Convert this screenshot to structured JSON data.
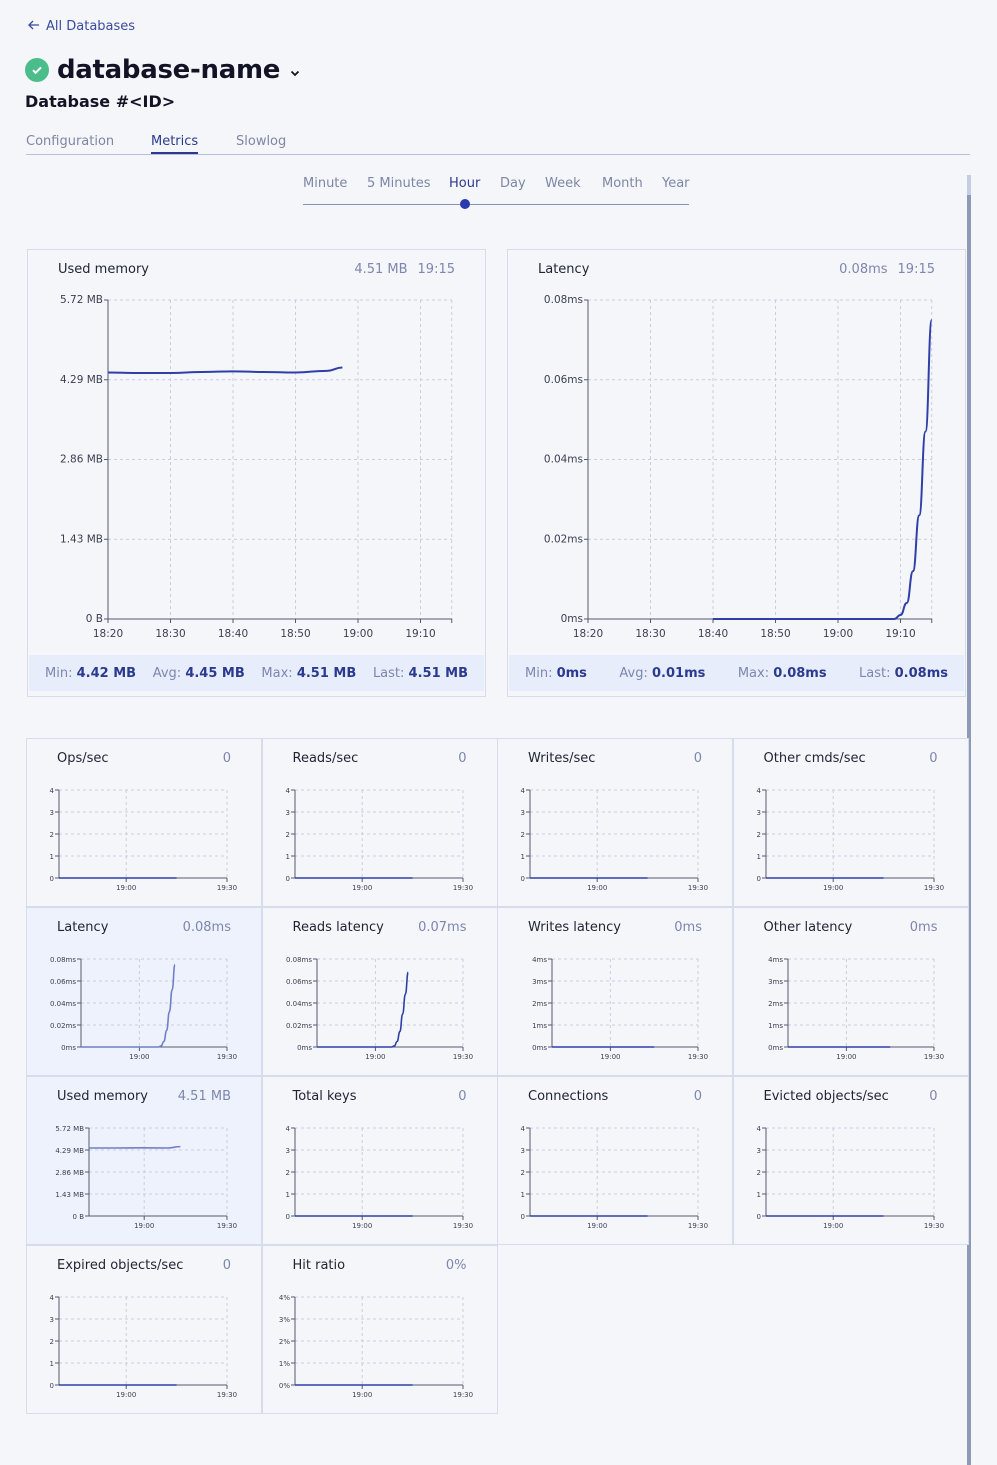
{
  "header": {
    "back_label": "All Databases",
    "db_name": "database-name",
    "db_id": "Database #<ID>"
  },
  "tabs": [
    {
      "label": "Configuration"
    },
    {
      "label": "Metrics"
    },
    {
      "label": "Slowlog"
    }
  ],
  "active_tab": "Metrics",
  "periods": [
    {
      "label": "Minute"
    },
    {
      "label": "5 Minutes"
    },
    {
      "label": "Hour"
    },
    {
      "label": "Day"
    },
    {
      "label": "Week"
    },
    {
      "label": "Month"
    },
    {
      "label": "Year"
    }
  ],
  "active_period": "Hour",
  "colors": {
    "accent": "#2a3a8f",
    "line": "#2f3fa8",
    "status_ok": "#4bbd8a"
  },
  "big_cards": [
    {
      "title": "Used memory",
      "current": "4.51 MB",
      "time": "19:15",
      "stats": {
        "min_label": "Min:",
        "min": "4.42 MB",
        "avg_label": "Avg:",
        "avg": "4.45 MB",
        "max_label": "Max:",
        "max": "4.51 MB",
        "last_label": "Last:",
        "last": "4.51 MB"
      }
    },
    {
      "title": "Latency",
      "current": "0.08ms",
      "time": "19:15",
      "stats": {
        "min_label": "Min:",
        "min": "0ms",
        "avg_label": "Avg:",
        "avg": "0.01ms",
        "max_label": "Max:",
        "max": "0.08ms",
        "last_label": "Last:",
        "last": "0.08ms"
      }
    }
  ],
  "small_cards": [
    {
      "title": "Ops/sec",
      "current": "0"
    },
    {
      "title": "Reads/sec",
      "current": "0"
    },
    {
      "title": "Writes/sec",
      "current": "0"
    },
    {
      "title": "Other cmds/sec",
      "current": "0"
    },
    {
      "title": "Latency",
      "current": "0.08ms"
    },
    {
      "title": "Reads latency",
      "current": "0.07ms"
    },
    {
      "title": "Writes latency",
      "current": "0ms"
    },
    {
      "title": "Other latency",
      "current": "0ms"
    },
    {
      "title": "Used memory",
      "current": "4.51 MB"
    },
    {
      "title": "Total keys",
      "current": "0"
    },
    {
      "title": "Connections",
      "current": "0"
    },
    {
      "title": "Evicted objects/sec",
      "current": "0"
    },
    {
      "title": "Expired objects/sec",
      "current": "0"
    },
    {
      "title": "Hit ratio",
      "current": "0%"
    }
  ],
  "chart_data": [
    {
      "type": "line",
      "title": "Used memory",
      "x_ticks": [
        "18:20",
        "18:30",
        "18:40",
        "18:50",
        "19:00",
        "19:10"
      ],
      "y_ticks": [
        "0 B",
        "1.43 MB",
        "2.86 MB",
        "4.29 MB",
        "5.72 MB"
      ],
      "ylim": [
        0,
        5.72
      ],
      "series": [
        {
          "x_min": [
            20,
            25,
            30,
            35,
            40,
            45,
            50,
            55,
            57.5
          ],
          "y": [
            4.42,
            4.41,
            4.41,
            4.43,
            4.44,
            4.43,
            4.42,
            4.45,
            4.51
          ]
        }
      ]
    },
    {
      "type": "line",
      "title": "Latency",
      "x_ticks": [
        "18:20",
        "18:30",
        "18:40",
        "18:50",
        "19:00",
        "19:10"
      ],
      "y_ticks": [
        "0ms",
        "0.02ms",
        "0.04ms",
        "0.06ms",
        "0.08ms"
      ],
      "ylim": [
        0,
        0.08
      ],
      "series": [
        {
          "x_min": [
            40,
            50,
            60,
            68,
            69,
            70,
            71,
            72,
            73,
            74,
            75
          ],
          "y": [
            0,
            0,
            0,
            0,
            0,
            0.001,
            0.004,
            0.012,
            0.026,
            0.047,
            0.075
          ]
        }
      ]
    },
    {
      "type": "line",
      "title": "Ops/sec",
      "x_ticks": [
        "19:00",
        "19:30"
      ],
      "y_ticks": [
        "0",
        "1",
        "2",
        "3",
        "4"
      ],
      "ylim": [
        0,
        4
      ],
      "series": [
        {
          "x_min": [
            0,
            37
          ],
          "y": [
            0,
            0
          ]
        }
      ]
    },
    {
      "type": "line",
      "title": "Reads/sec",
      "x_ticks": [
        "19:00",
        "19:30"
      ],
      "y_ticks": [
        "0",
        "1",
        "2",
        "3",
        "4"
      ],
      "ylim": [
        0,
        4
      ],
      "series": [
        {
          "x_min": [
            0,
            37
          ],
          "y": [
            0,
            0
          ]
        }
      ]
    },
    {
      "type": "line",
      "title": "Writes/sec",
      "x_ticks": [
        "19:00",
        "19:30"
      ],
      "y_ticks": [
        "0",
        "1",
        "2",
        "3",
        "4"
      ],
      "ylim": [
        0,
        4
      ],
      "series": [
        {
          "x_min": [
            0,
            37
          ],
          "y": [
            0,
            0
          ]
        }
      ]
    },
    {
      "type": "line",
      "title": "Other cmds/sec",
      "x_ticks": [
        "19:00",
        "19:30"
      ],
      "y_ticks": [
        "0",
        "1",
        "2",
        "3",
        "4"
      ],
      "ylim": [
        0,
        4
      ],
      "series": [
        {
          "x_min": [
            0,
            37
          ],
          "y": [
            0,
            0
          ]
        }
      ]
    },
    {
      "type": "line",
      "title": "Latency",
      "x_ticks": [
        "19:00",
        "19:30"
      ],
      "y_ticks": [
        "0ms",
        "0.02ms",
        "0.04ms",
        "0.06ms",
        "0.08ms"
      ],
      "ylim": [
        0,
        0.08
      ],
      "series": [
        {
          "x_min": [
            0,
            28,
            29,
            30,
            31,
            32,
            33,
            34
          ],
          "y": [
            0,
            0,
            0.001,
            0.005,
            0.015,
            0.032,
            0.052,
            0.075
          ]
        }
      ]
    },
    {
      "type": "line",
      "title": "Reads latency",
      "x_ticks": [
        "19:00",
        "19:30"
      ],
      "y_ticks": [
        "0ms",
        "0.02ms",
        "0.04ms",
        "0.06ms",
        "0.08ms"
      ],
      "ylim": [
        0,
        0.08
      ],
      "series": [
        {
          "x_min": [
            0,
            27,
            28,
            29,
            30,
            31,
            32,
            33
          ],
          "y": [
            0,
            0,
            0.001,
            0.005,
            0.014,
            0.03,
            0.048,
            0.068
          ]
        }
      ]
    },
    {
      "type": "line",
      "title": "Writes latency",
      "x_ticks": [
        "19:00",
        "19:30"
      ],
      "y_ticks": [
        "0ms",
        "1ms",
        "2ms",
        "3ms",
        "4ms"
      ],
      "ylim": [
        0,
        4
      ],
      "series": [
        {
          "x_min": [
            0,
            37
          ],
          "y": [
            0,
            0
          ]
        }
      ]
    },
    {
      "type": "line",
      "title": "Other latency",
      "x_ticks": [
        "19:00",
        "19:30"
      ],
      "y_ticks": [
        "0ms",
        "1ms",
        "2ms",
        "3ms",
        "4ms"
      ],
      "ylim": [
        0,
        4
      ],
      "series": [
        {
          "x_min": [
            0,
            37
          ],
          "y": [
            0,
            0
          ]
        }
      ]
    },
    {
      "type": "line",
      "title": "Used memory",
      "x_ticks": [
        "19:00",
        "19:30"
      ],
      "y_ticks": [
        "0 B",
        "1.43 MB",
        "2.86 MB",
        "4.29 MB",
        "5.72 MB"
      ],
      "ylim": [
        0,
        5.72
      ],
      "series": [
        {
          "x_min": [
            0,
            10,
            20,
            30,
            35
          ],
          "y": [
            4.42,
            4.42,
            4.43,
            4.42,
            4.51
          ]
        }
      ]
    },
    {
      "type": "line",
      "title": "Total keys",
      "x_ticks": [
        "19:00",
        "19:30"
      ],
      "y_ticks": [
        "0",
        "1",
        "2",
        "3",
        "4"
      ],
      "ylim": [
        0,
        4
      ],
      "series": [
        {
          "x_min": [
            0,
            37
          ],
          "y": [
            0,
            0
          ]
        }
      ]
    },
    {
      "type": "line",
      "title": "Connections",
      "x_ticks": [
        "19:00",
        "19:30"
      ],
      "y_ticks": [
        "0",
        "1",
        "2",
        "3",
        "4"
      ],
      "ylim": [
        0,
        4
      ],
      "series": [
        {
          "x_min": [
            0,
            37
          ],
          "y": [
            0,
            0
          ]
        }
      ]
    },
    {
      "type": "line",
      "title": "Evicted objects/sec",
      "x_ticks": [
        "19:00",
        "19:30"
      ],
      "y_ticks": [
        "0",
        "1",
        "2",
        "3",
        "4"
      ],
      "ylim": [
        0,
        4
      ],
      "series": [
        {
          "x_min": [
            0,
            37
          ],
          "y": [
            0,
            0
          ]
        }
      ]
    },
    {
      "type": "line",
      "title": "Expired objects/sec",
      "x_ticks": [
        "19:00",
        "19:30"
      ],
      "y_ticks": [
        "0",
        "1",
        "2",
        "3",
        "4"
      ],
      "ylim": [
        0,
        4
      ],
      "series": [
        {
          "x_min": [
            0,
            37
          ],
          "y": [
            0,
            0
          ]
        }
      ]
    },
    {
      "type": "line",
      "title": "Hit ratio",
      "x_ticks": [
        "19:00",
        "19:30"
      ],
      "y_ticks": [
        "0%",
        "1%",
        "2%",
        "3%",
        "4%"
      ],
      "ylim": [
        0,
        4
      ],
      "series": [
        {
          "x_min": [
            0,
            37
          ],
          "y": [
            0,
            0
          ]
        }
      ]
    }
  ]
}
